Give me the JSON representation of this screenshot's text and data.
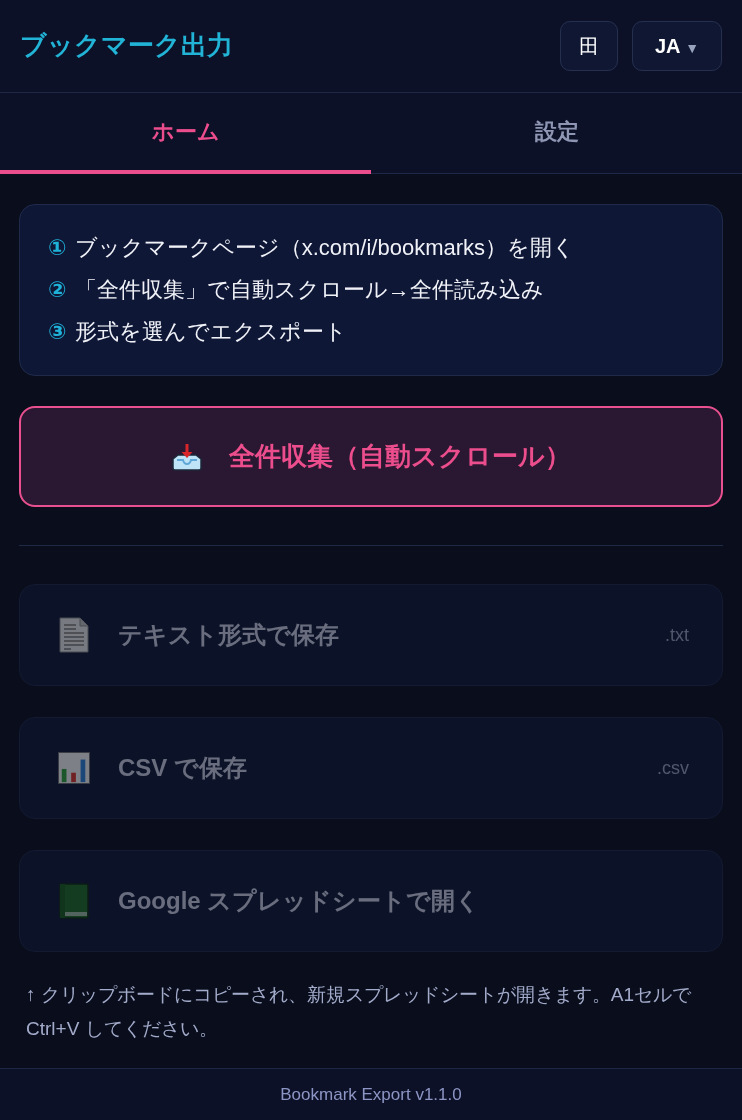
{
  "header": {
    "title": "ブックマーク出力",
    "grid_button": {
      "glyph": "田"
    },
    "language_button": {
      "label": "JA",
      "caret": "▼"
    }
  },
  "tabs": [
    {
      "label": "ホーム",
      "selected": true
    },
    {
      "label": "設定",
      "selected": false
    }
  ],
  "steps": [
    {
      "number": "①",
      "text": "ブックマークページ（x.com/i/bookmarks）を開く"
    },
    {
      "number": "②",
      "text": "「全件収集」で自動スクロール→全件読み込み"
    },
    {
      "number": "③",
      "text": "形式を選んでエクスポート"
    }
  ],
  "collect_button": {
    "label": "全件収集（自動スクロール）"
  },
  "export_buttons": [
    {
      "kind": "text",
      "label": "テキスト形式で保存",
      "extension": ".txt",
      "disabled": true
    },
    {
      "kind": "csv",
      "label": "CSV で保存",
      "extension": ".csv",
      "disabled": true
    },
    {
      "kind": "sheet",
      "label": "Google スプレッドシートで開く",
      "disabled": true
    }
  ],
  "note": "↑ クリップボードにコピーされ、新規スプレッドシートが開きます。A1セルで Ctrl+V してください。",
  "footer": "Bookmark Export v1.1.0"
}
